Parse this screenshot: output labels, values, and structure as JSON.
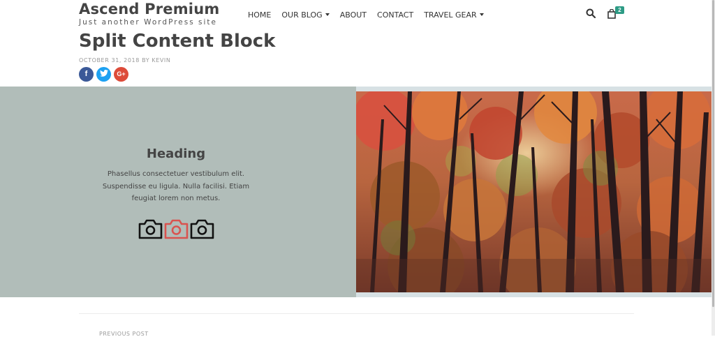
{
  "site": {
    "title": "Ascend Premium",
    "tagline": "Just another WordPress site"
  },
  "nav": {
    "items": [
      {
        "label": "HOME",
        "dropdown": false
      },
      {
        "label": "OUR BLOG",
        "dropdown": true
      },
      {
        "label": "ABOUT",
        "dropdown": false
      },
      {
        "label": "CONTACT",
        "dropdown": false
      },
      {
        "label": "TRAVEL GEAR",
        "dropdown": true
      }
    ]
  },
  "cart": {
    "count": "2"
  },
  "post": {
    "title": "Split Content Block",
    "meta": "OCTOBER 31, 2018 BY KEVIN"
  },
  "social": [
    {
      "icon": "facebook-icon",
      "glyph": "f",
      "color": "#3b5998"
    },
    {
      "icon": "twitter-icon",
      "glyph": "t",
      "color": "#1da1f2"
    },
    {
      "icon": "google-plus-icon",
      "glyph": "G+",
      "color": "#dd4b39"
    }
  ],
  "split_block": {
    "heading": "Heading",
    "text": "Phasellus consectetuer vestibulum elit. Suspendisse eu ligula. Nulla facilisi. Etiam feugiat lorem non metus.",
    "left_bg_color": "#b1bdb9",
    "icons": [
      "camera-icon",
      "camera-icon",
      "camera-icon"
    ],
    "icon_colors": [
      "#111111",
      "#d9534f",
      "#111111"
    ]
  },
  "footer_nav": {
    "previous_label": "PREVIOUS POST"
  },
  "colors": {
    "text": "#444444",
    "accent": "#2d9b85"
  }
}
